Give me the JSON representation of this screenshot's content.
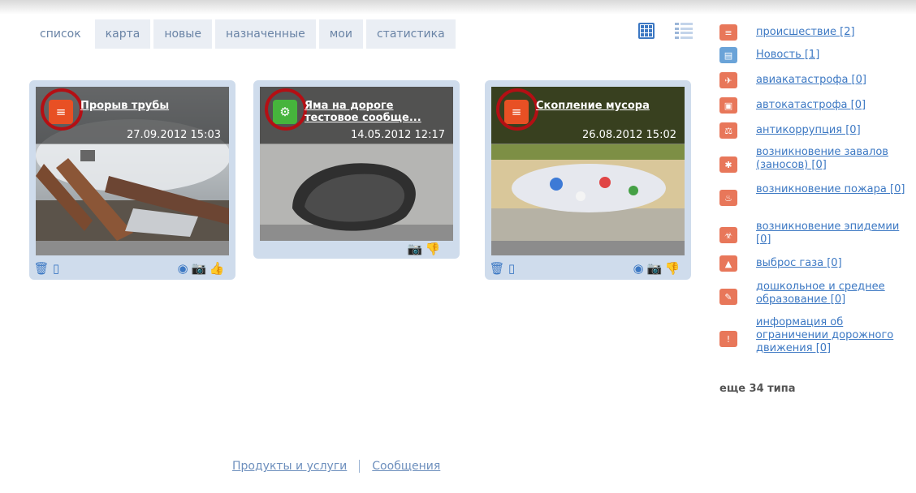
{
  "tabs": [
    {
      "label": "список",
      "active": true
    },
    {
      "label": "карта"
    },
    {
      "label": "новые"
    },
    {
      "label": "назначенные"
    },
    {
      "label": "мои"
    },
    {
      "label": "статистика"
    }
  ],
  "view_modes": {
    "grid_icon": "grid-icon",
    "list_icon": "list-icon",
    "active": "grid"
  },
  "cards": [
    {
      "title": "Прорыв трубы",
      "subtitle": "",
      "date": "27.09.2012 15:03",
      "category_icon": "accident-icon",
      "category_color": "#e85024",
      "actions_left": [
        "trash-icon",
        "pin-icon"
      ],
      "actions_right": [
        "target-icon",
        "camera-icon",
        "thumbs-up-icon"
      ]
    },
    {
      "title": "Яма на дороге",
      "subtitle": "тестовое сообще...",
      "date": "14.05.2012 12:17",
      "category_icon": "news-icon",
      "category_color": "#46b43c",
      "actions_left": [],
      "actions_right": [
        "camera-icon",
        "thumbs-down-icon"
      ]
    },
    {
      "title": "Скопление мусора",
      "subtitle": "",
      "date": "26.08.2012 15:02",
      "category_icon": "accident-icon",
      "category_color": "#e85024",
      "actions_left": [
        "trash-icon",
        "pin-icon"
      ],
      "actions_right": [
        "target-icon",
        "camera-icon",
        "thumbs-down-icon"
      ]
    }
  ],
  "types": [
    {
      "label": "происшествие [2]",
      "color": "#e8775a"
    },
    {
      "label": "Новость [1]",
      "color": "#6aa3d8"
    },
    {
      "label": "авиакатастрофа [0]",
      "color": "#e8775a"
    },
    {
      "label": "автокатастрофа [0]",
      "color": "#e8775a"
    },
    {
      "label": "антикоррупция [0]",
      "color": "#e8775a"
    },
    {
      "label": "возникновение завалов (заносов) [0]",
      "color": "#e8775a"
    },
    {
      "label": "возникновение пожара [0]",
      "color": "#e8775a"
    },
    {
      "label": "возникновение эпидемии [0]",
      "color": "#e8775a"
    },
    {
      "label": "выброс газа [0]",
      "color": "#e8775a"
    },
    {
      "label": "дошкольное и среднее образование [0]",
      "color": "#e8775a"
    },
    {
      "label": "информация об ограничении дорожного движения [0]",
      "color": "#e8775a"
    }
  ],
  "more_types": "еще 34 типа",
  "footer": {
    "products": "Продукты и услуги",
    "messages": "Сообщения"
  }
}
